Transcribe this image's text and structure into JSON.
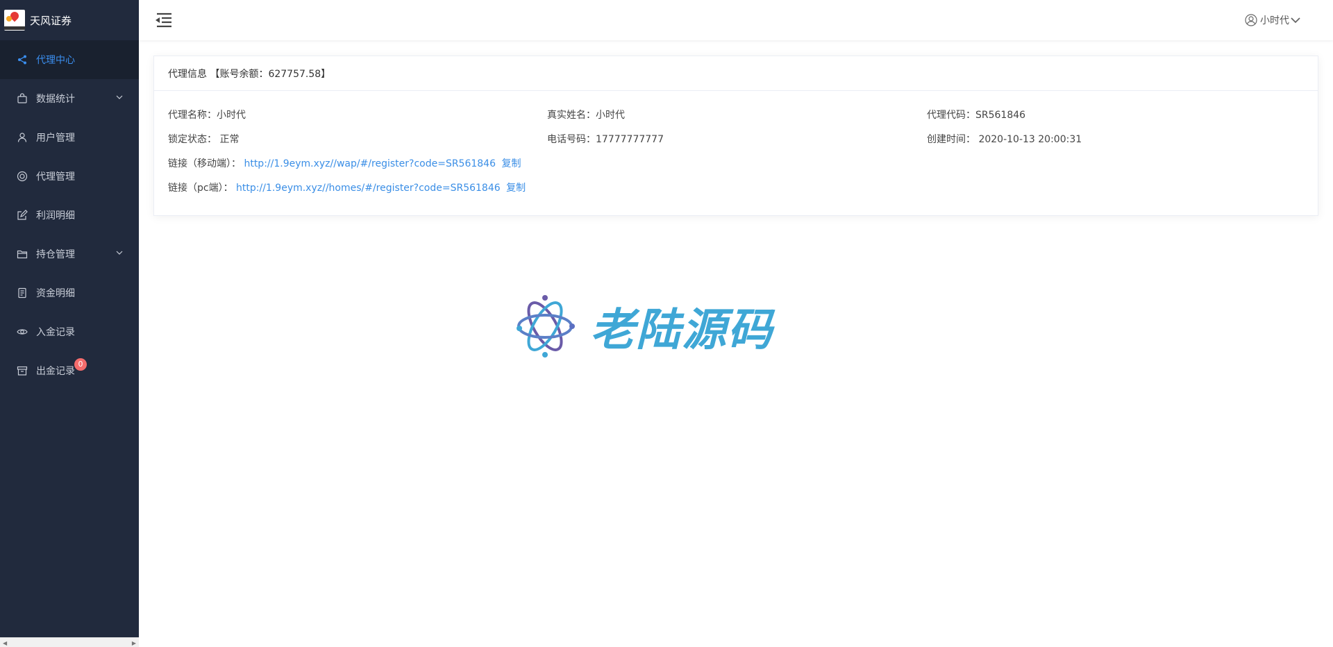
{
  "brand": {
    "name": "天风证券"
  },
  "sidebar": {
    "items": [
      {
        "label": "代理中心",
        "icon": "share-icon",
        "active": true
      },
      {
        "label": "数据统计",
        "icon": "bag-icon",
        "has_submenu": true
      },
      {
        "label": "用户管理",
        "icon": "user-icon"
      },
      {
        "label": "代理管理",
        "icon": "help-circle-icon"
      },
      {
        "label": "利润明细",
        "icon": "edit-icon"
      },
      {
        "label": "持仓管理",
        "icon": "folder-icon",
        "has_submenu": true
      },
      {
        "label": "资金明细",
        "icon": "document-icon"
      },
      {
        "label": "入金记录",
        "icon": "eye-icon"
      },
      {
        "label": "出金记录",
        "icon": "box-icon",
        "badge": "0"
      }
    ]
  },
  "header": {
    "user_name": "小时代"
  },
  "card": {
    "title": "代理信息 【账号余额：627757.58】",
    "fields": {
      "agent_name": "代理名称：小时代",
      "real_name": "真实姓名：小时代",
      "agent_code": "代理代码：SR561846",
      "lock_status": "锁定状态： 正常",
      "phone": "电话号码：17777777777",
      "created": "创建时间： 2020-10-13 20:00:31",
      "mobile_link_label": "链接（移动端）：",
      "mobile_link": "http://1.9eym.xyz//wap/#/register?code=SR561846",
      "pc_link_label": "链接（pc端）：",
      "pc_link": "http://1.9eym.xyz//homes/#/register?code=SR561846",
      "copy_label": "复制"
    }
  },
  "watermark": {
    "text": "老陆源码"
  },
  "colors": {
    "sidebar_bg": "#212a3d",
    "active": "#3b8ff0",
    "link": "#3a8ee6",
    "badge": "#f56c6c",
    "watermark": "#3fa7d6"
  }
}
